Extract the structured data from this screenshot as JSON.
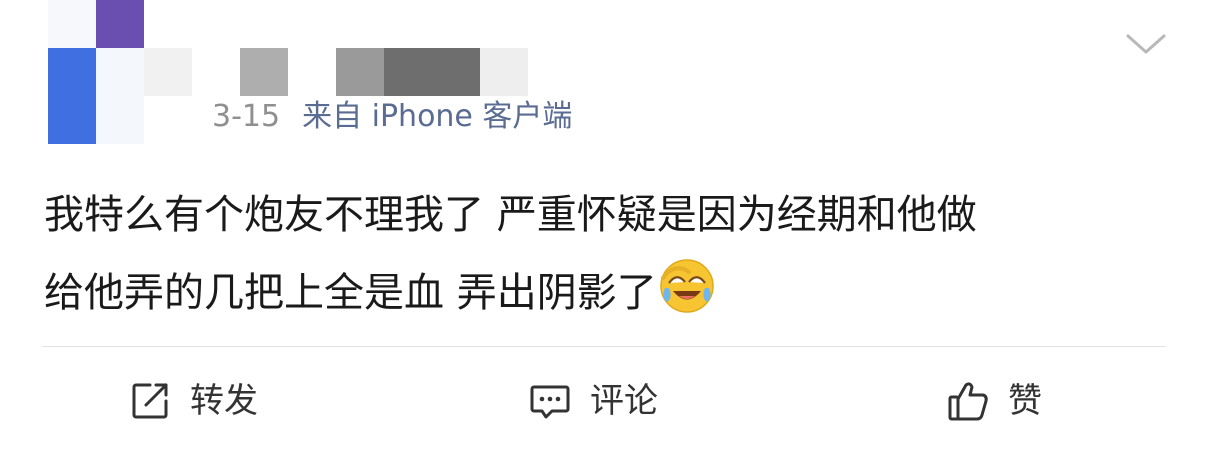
{
  "post": {
    "date": "3-15",
    "source": "来自 iPhone 客户端",
    "content_line1": "我特么有个炮友不理我了 严重怀疑是因为经期和他做",
    "content_line2": "给他弄的几把上全是血 弄出阴影了",
    "emoji": "laughing-crying-face"
  },
  "actions": {
    "repost_label": "转发",
    "comment_label": "评论",
    "like_label": "赞"
  },
  "colors": {
    "meta_text": "#8f8f8f",
    "source_text": "#5b6c92",
    "content_text": "#1a1a1a",
    "action_text": "#333333",
    "divider": "#e3e3e3"
  },
  "icons": {
    "menu": "chevron-down-icon",
    "repost": "repost-icon",
    "comment": "comment-icon",
    "like": "thumbs-up-icon"
  }
}
